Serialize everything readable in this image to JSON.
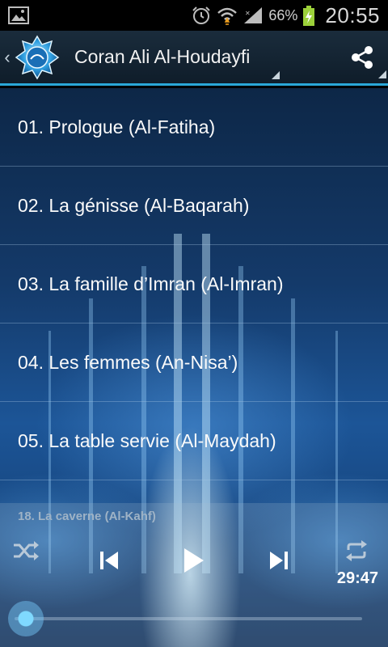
{
  "status_bar": {
    "battery_percent": "66%",
    "time": "20:55"
  },
  "action_bar": {
    "title": "Coran Ali Al-Houdayfi",
    "up_glyph": "‹",
    "logo_icon": "app-logo-icon",
    "share_icon": "share-icon"
  },
  "tracks": [
    {
      "label": "01. Prologue (Al-Fatiha)"
    },
    {
      "label": "02. La génisse (Al-Baqarah)"
    },
    {
      "label": "03. La famille d’Imran (Al-Imran)"
    },
    {
      "label": "04. Les femmes (An-Nisa’)"
    },
    {
      "label": "05. La table servie (Al-Maydah)"
    }
  ],
  "player": {
    "now_playing": "18. La caverne (Al-Kahf)",
    "time": "29:47",
    "progress_fraction": 0.0,
    "icons": [
      "shuffle-icon",
      "previous-icon",
      "play-icon",
      "next-icon",
      "repeat-icon"
    ]
  },
  "colors": {
    "accent": "#2aa7d8",
    "actionbar_bg": "#16283a",
    "seek_knob": "#7fd9ff"
  }
}
